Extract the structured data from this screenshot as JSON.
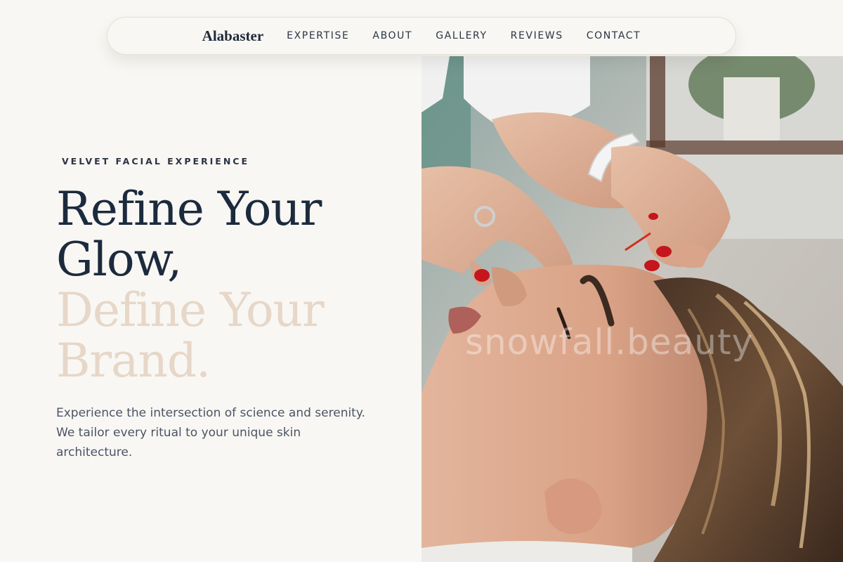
{
  "nav": {
    "brand": "Alabaster",
    "links": [
      "EXPERTISE",
      "ABOUT",
      "GALLERY",
      "REVIEWS",
      "CONTACT"
    ]
  },
  "hero": {
    "eyebrow": "VELVET FACIAL EXPERIENCE",
    "headline_line1": "Refine Your",
    "headline_line2": "Glow,",
    "headline_line3": "Define Your",
    "headline_line4": "Brand.",
    "body": "Experience the intersection of science and serenity. We tailor every ritual to your unique skin architecture.",
    "watermark": "snowfall.beauty"
  },
  "colors": {
    "background": "#f9f7f3",
    "headline_dark": "#1c2a3e",
    "headline_accent": "#e6d7c8",
    "body_text": "#4a5466",
    "nail_red": "#c4161c"
  }
}
